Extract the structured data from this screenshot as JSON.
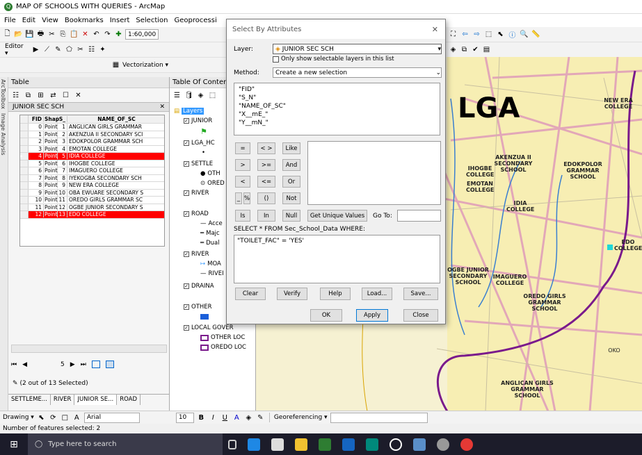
{
  "app": {
    "title": "MAP OF SCHOOLS WITH QUERIES - ArcMap"
  },
  "menu": [
    "File",
    "Edit",
    "View",
    "Bookmarks",
    "Insert",
    "Selection",
    "Geoprocessi"
  ],
  "toolbar": {
    "scale": "1:60,000",
    "editor": "Editor ▾",
    "vectorization": "Vectorization ▾"
  },
  "table": {
    "title": "Table",
    "close": "✕",
    "layer_tab": "JUNIOR SEC SCH",
    "columns": [
      "FID",
      "Shap",
      "S_",
      "NAME_OF_SC"
    ],
    "rows": [
      {
        "fid": "0",
        "shape": "Point",
        "s": "1",
        "name": "ANGLICAN GIRLS GRAMMAR",
        "sel": false
      },
      {
        "fid": "1",
        "shape": "Point",
        "s": "2",
        "name": "AKENZUA II SECONDARY SCI",
        "sel": false
      },
      {
        "fid": "2",
        "shape": "Point",
        "s": "3",
        "name": "EDOKPOLOR GRAMMAR SCH",
        "sel": false
      },
      {
        "fid": "3",
        "shape": "Point",
        "s": "4",
        "name": "EMOTAN COLLEGE",
        "sel": false
      },
      {
        "fid": "4",
        "shape": "Point",
        "s": "5",
        "name": "IDIA COLLEGE",
        "sel": true
      },
      {
        "fid": "5",
        "shape": "Point",
        "s": "6",
        "name": "IHOGBE COLLEGE",
        "sel": false
      },
      {
        "fid": "6",
        "shape": "Point",
        "s": "7",
        "name": "IMAGUERO COLLEGE",
        "sel": false
      },
      {
        "fid": "7",
        "shape": "Point",
        "s": "8",
        "name": "IYEKOGBA SECONDARY SCH",
        "sel": false
      },
      {
        "fid": "8",
        "shape": "Point",
        "s": "9",
        "name": "NEW ERA COLLEGE",
        "sel": false
      },
      {
        "fid": "9",
        "shape": "Point",
        "s": "10",
        "name": "OBA EWUARE SECONDARY S",
        "sel": false
      },
      {
        "fid": "10",
        "shape": "Point",
        "s": "11",
        "name": "OREDO GIRLS GRAMMAR SC",
        "sel": false
      },
      {
        "fid": "11",
        "shape": "Point",
        "s": "12",
        "name": "OGBE JUNIOR SECONDARY S",
        "sel": false
      },
      {
        "fid": "12",
        "shape": "Point",
        "s": "13",
        "name": "EDO COLLEGE",
        "sel": true
      }
    ],
    "record_nav": "5",
    "selected_text": "(2 out of 13 Selected)",
    "tabs": [
      "SETTLEME...",
      "RIVER",
      "JUNIOR SE...",
      "ROAD"
    ]
  },
  "toc": {
    "title": "Table Of Contents",
    "root": "Layers",
    "items": [
      "JUNIOR",
      "LGA_HC",
      "SETTLE",
      "OTH",
      "ORED",
      "RIVER",
      "ROAD",
      "Acce",
      "Majc",
      "Dual",
      "RIVER",
      "MOA",
      "RIVEI",
      "DRAINA",
      "OTHER",
      "LOCAL GOVER",
      "OTHER LOC",
      "OREDO LOC"
    ]
  },
  "dialog": {
    "title": "Select By Attributes",
    "layer_label": "Layer:",
    "layer_value": "JUNIOR SEC SCH",
    "only_selectable": "Only show selectable layers in this list",
    "method_label": "Method:",
    "method_value": "Create a new selection",
    "fields": [
      "\"FID\"",
      "\"S_N\"",
      "\"NAME_OF_SC\"",
      "\"X__mE_\"",
      "\"Y__mN_\""
    ],
    "ops": [
      "=",
      "< >",
      "Like",
      ">",
      ">=",
      "And",
      "<",
      "<=",
      "Or",
      "_",
      "%",
      "()",
      "Not",
      "Is",
      "In",
      "Null"
    ],
    "unique_btn": "Get Unique Values",
    "goto": "Go To:",
    "sql_prefix": "SELECT * FROM Sec_School_Data WHERE:",
    "expression": "\"TOILET_FAC\" = 'YES'",
    "buttons": [
      "Clear",
      "Verify",
      "Help",
      "Load...",
      "Save..."
    ],
    "ok": "OK",
    "apply": "Apply",
    "close": "Close"
  },
  "map": {
    "big_label": "LGA",
    "labels": [
      "NEW ERA COLLEGE",
      "AKENZUA II SECONDARY SCHOOL",
      "EDOKPOLOR GRAMMAR SCHOOL",
      "IHOGBE COLLEGE",
      "EMOTAN COLLEGE",
      "IDIA COLLEGE",
      "OGBE JUNIOR SECONDARY SCHOOL",
      "IMAGUERO COLLEGE",
      "OREDO GIRLS GRAMMAR SCHOOL",
      "EDO COLLEGE",
      "ANGLICAN GIRLS GRAMMAR SCHOOL",
      "OKO"
    ]
  },
  "drawing": {
    "label": "Drawing ▾",
    "font": "Arial",
    "size": "10",
    "georef": "Georeferencing ▾"
  },
  "status": "Number of features selected: 2",
  "taskbar": {
    "search": "Type here to search"
  }
}
